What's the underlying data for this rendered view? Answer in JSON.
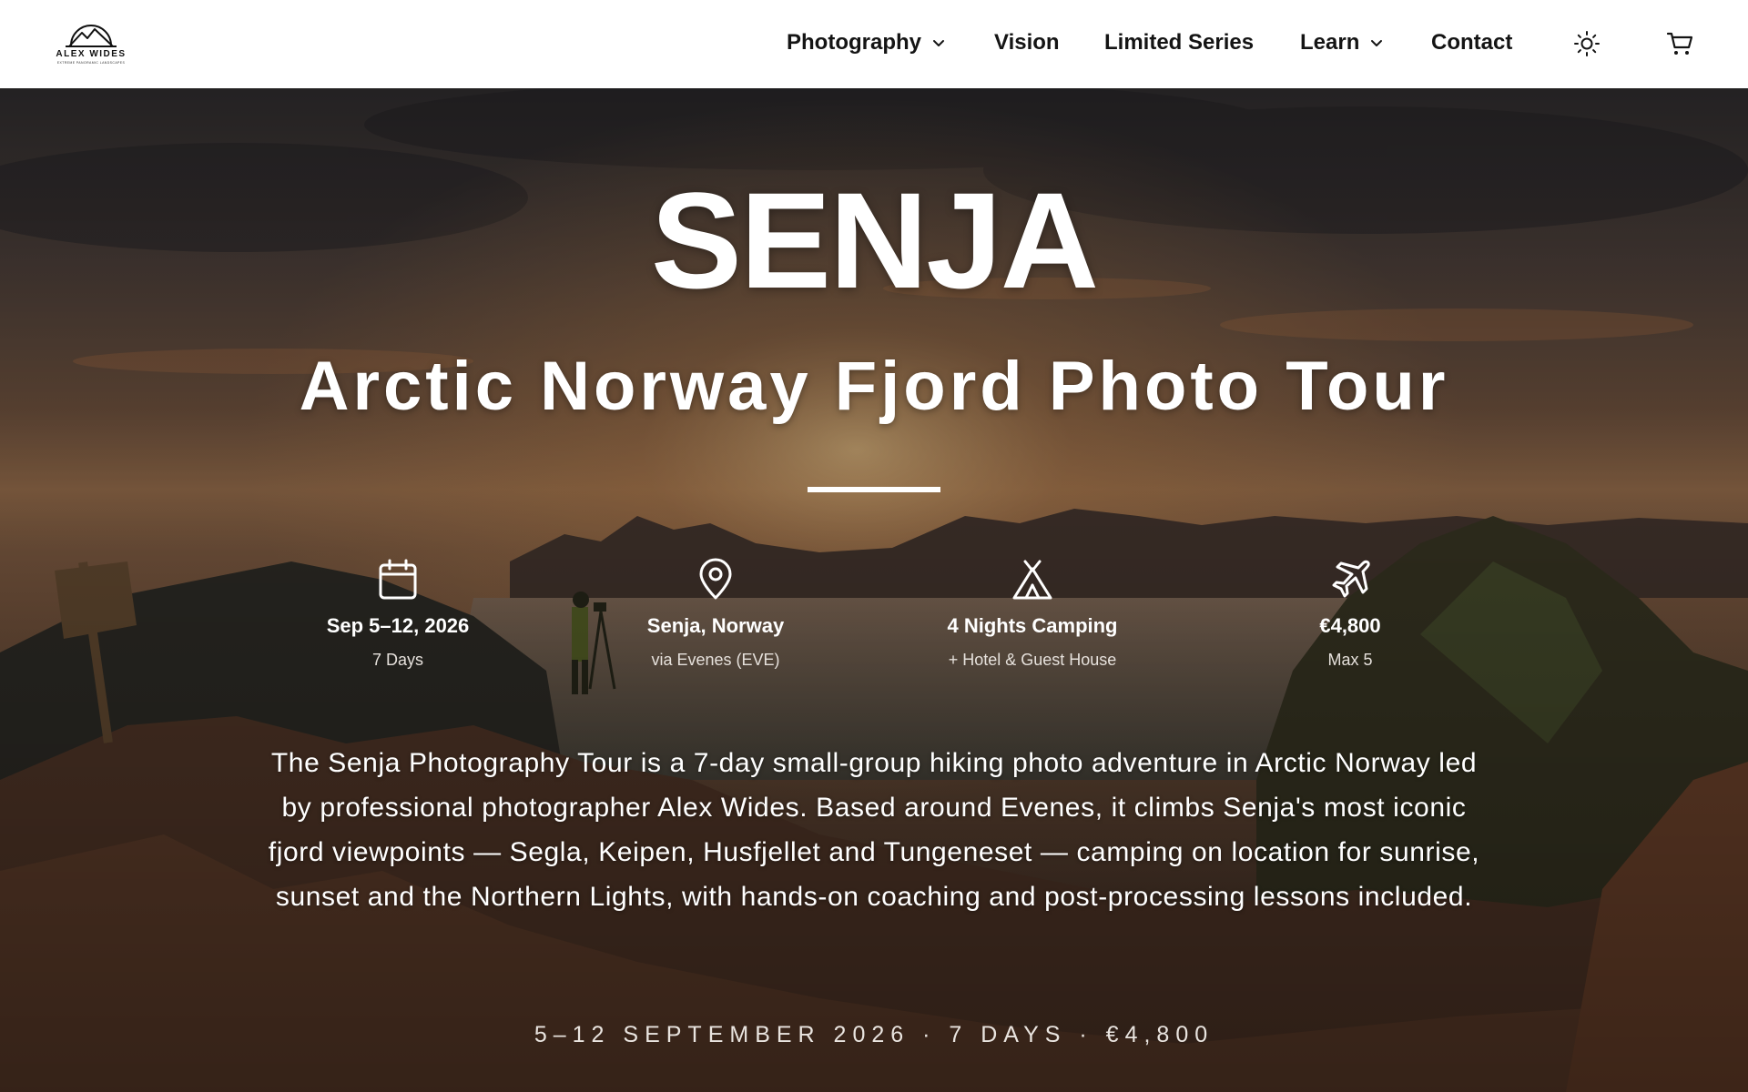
{
  "brand": {
    "name": "ALEX WIDES",
    "tagline": "EXTREME PANORAMIC LANDSCAPES"
  },
  "nav": {
    "items": [
      {
        "label": "Photography",
        "dropdown": true
      },
      {
        "label": "Vision",
        "dropdown": false
      },
      {
        "label": "Limited Series",
        "dropdown": false
      },
      {
        "label": "Learn",
        "dropdown": true
      },
      {
        "label": "Contact",
        "dropdown": false
      }
    ],
    "icons": [
      "sun-icon",
      "cart-icon"
    ]
  },
  "hero": {
    "title": "SENJA",
    "subtitle": "Arctic Norway Fjord Photo Tour",
    "facts": [
      {
        "icon": "calendar-icon",
        "main": "Sep 5–12, 2026",
        "sub": "7 Days"
      },
      {
        "icon": "map-pin-icon",
        "main": "Senja, Norway",
        "sub": "via Evenes (EVE)"
      },
      {
        "icon": "tent-icon",
        "main": "4 Nights Camping",
        "sub": "+ Hotel & Guest House"
      },
      {
        "icon": "plane-icon",
        "main": "€4,800",
        "sub": "Max 5"
      }
    ],
    "description": "The Senja Photography Tour is a 7-day small-group hiking photo adventure in Arctic Norway led by professional photographer Alex Wides. Based around Evenes, it climbs Senja's most iconic fjord viewpoints — Segla, Keipen, Husfjellet and Tungeneset — camping on location for sunrise, sunset and the Northern Lights, with hands-on coaching and post-processing lessons included.",
    "tagline": "5–12 SEPTEMBER 2026 · 7 DAYS · €4,800"
  },
  "colors": {
    "nav_bg": "#ffffff",
    "nav_text": "#141414",
    "hero_text": "#ffffff"
  }
}
